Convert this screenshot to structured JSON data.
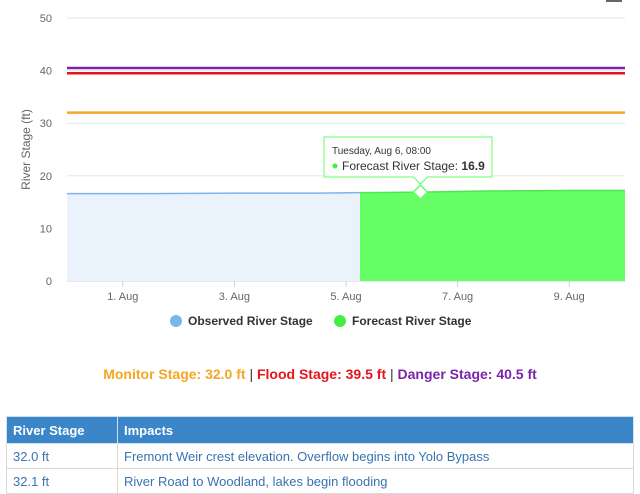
{
  "chart_data": {
    "type": "area",
    "ylabel": "River Stage (ft)",
    "ylim": [
      0,
      50
    ],
    "y_ticks": [
      0,
      10,
      20,
      30,
      40,
      50
    ],
    "x_range": [
      "2024-07-31",
      "2024-08-10"
    ],
    "x_ticks": [
      {
        "date": "2024-08-01",
        "label": "1. Aug"
      },
      {
        "date": "2024-08-03",
        "label": "3. Aug"
      },
      {
        "date": "2024-08-05",
        "label": "5. Aug"
      },
      {
        "date": "2024-08-07",
        "label": "7. Aug"
      },
      {
        "date": "2024-08-09",
        "label": "9. Aug"
      }
    ],
    "grid": true,
    "legend_position": "bottom",
    "series": [
      {
        "name": "Observed River Stage",
        "color": "#7cb5ec",
        "fill": "#eaf3fb",
        "x": [
          "2024-07-31T00:00",
          "2024-08-01T12:00",
          "2024-08-03T00:00",
          "2024-08-04T12:00",
          "2024-08-05T06:00"
        ],
        "values": [
          16.6,
          16.6,
          16.7,
          16.7,
          16.8
        ]
      },
      {
        "name": "Forecast River Stage",
        "color": "#52e552",
        "fill": "#66ff66",
        "x": [
          "2024-08-05T06:00",
          "2024-08-06T08:00",
          "2024-08-07T12:00",
          "2024-08-09T00:00",
          "2024-08-10T00:00"
        ],
        "values": [
          16.8,
          16.9,
          17.1,
          17.2,
          17.2
        ]
      }
    ],
    "threshold_lines": [
      {
        "label": "Monitor Stage",
        "value": 32.0,
        "color": "#f5a623"
      },
      {
        "label": "Flood Stage",
        "value": 39.5,
        "color": "#e8141c"
      },
      {
        "label": "Danger Stage",
        "value": 40.5,
        "color": "#7a25a8"
      }
    ],
    "tooltip": {
      "date_text": "Tuesday, Aug 6, 08:00",
      "series_text": "Forecast River Stage:",
      "value_text": "16.9",
      "x": "2024-08-06T08:00",
      "value": 16.9
    }
  },
  "stages": {
    "monitor_text": "Monitor Stage: 32.0 ft",
    "flood_text": "Flood Stage: 39.5 ft",
    "danger_text": "Danger Stage: 40.5 ft",
    "separator": "|"
  },
  "impacts": {
    "headers": [
      "River Stage",
      "Impacts"
    ],
    "rows": [
      {
        "stage": "32.0 ft",
        "impact": "Fremont Weir crest elevation. Overflow begins into Yolo Bypass"
      },
      {
        "stage": "32.1 ft",
        "impact": "River Road to Woodland, lakes begin flooding"
      }
    ]
  },
  "colors": {
    "header_bg": "#3a86c8",
    "link_text": "#3a73b0"
  },
  "icons": {
    "chart_menu": "hamburger-menu-icon"
  }
}
